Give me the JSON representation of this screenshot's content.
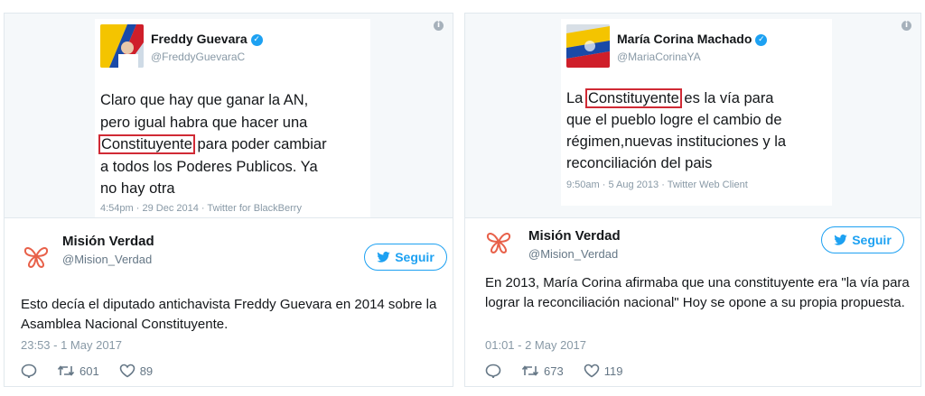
{
  "left": {
    "quoted": {
      "name": "Freddy Guevara",
      "handle": "@FreddyGuevaraC",
      "text_before": "Claro que hay que ganar la AN,\npero igual habra que hacer una\n",
      "highlight": "Constituyente",
      "text_after": " para poder cambiar\na todos los Poderes Publicos. Ya\nno hay otra",
      "meta": "4:54pm · 29 Dec 2014 · Twitter for BlackBerry"
    },
    "account": {
      "name": "Misión Verdad",
      "handle": "@Mision_Verdad",
      "follow_label": "Seguir"
    },
    "body": "Esto decía el diputado antichavista Freddy Guevara en 2014 sobre la Asamblea Nacional Constituyente.",
    "timestamp": "23:53 - 1 May 2017",
    "retweets": "601",
    "likes": "89"
  },
  "right": {
    "quoted": {
      "name": "María Corina Machado",
      "handle": "@MariaCorinaYA",
      "text_before": "La ",
      "highlight": "Constituyente",
      "text_after": " es la vía para\nque el pueblo logre el cambio de\nrégimen,nuevas instituciones y la\nreconciliación del pais",
      "meta": "9:50am · 5 Aug 2013 · Twitter Web Client"
    },
    "account": {
      "name": "Misión Verdad",
      "handle": "@Mision_Verdad",
      "follow_label": "Seguir"
    },
    "body": "En 2013, María Corina afirmaba que una constituyente era \"la vía para lograr la reconciliación nacional\" Hoy se opone a su propia propuesta.",
    "timestamp": "01:01 - 2 May 2017",
    "retweets": "673",
    "likes": "119"
  },
  "colors": {
    "accent": "#1da1f2",
    "highlight_box": "#d02a35",
    "muted": "#657786"
  },
  "icons": [
    "info-icon",
    "verified-icon",
    "twitter-bird-icon",
    "reply-icon",
    "retweet-icon",
    "like-icon",
    "mision-verdad-logo"
  ]
}
